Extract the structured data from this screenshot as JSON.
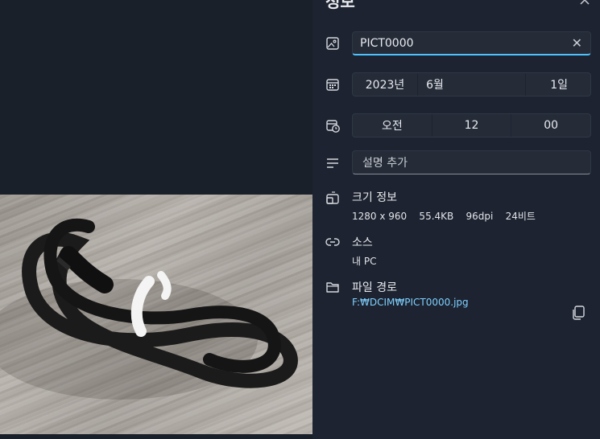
{
  "panel": {
    "title": "정보",
    "collapse_icon": "chevron-up-icon"
  },
  "name": {
    "value": "PICT0000",
    "clear_icon": "✕"
  },
  "date": {
    "year": "2023년",
    "month": "6월",
    "day": "1일"
  },
  "time": {
    "ampm": "오전",
    "hour": "12",
    "minute": "00"
  },
  "description": {
    "placeholder": "설명 추가"
  },
  "size_info": {
    "title": "크기 정보",
    "value": "1280 x 960    55.4KB    96dpi    24비트"
  },
  "source": {
    "title": "소스",
    "value": "내 PC"
  },
  "file_path": {
    "title": "파일 경로",
    "value": "F:₩DCIM₩PICT0000.jpg"
  },
  "colors": {
    "accent": "#4cc2ff",
    "link": "#7fd0ff",
    "panel_bg": "#1d2330"
  }
}
